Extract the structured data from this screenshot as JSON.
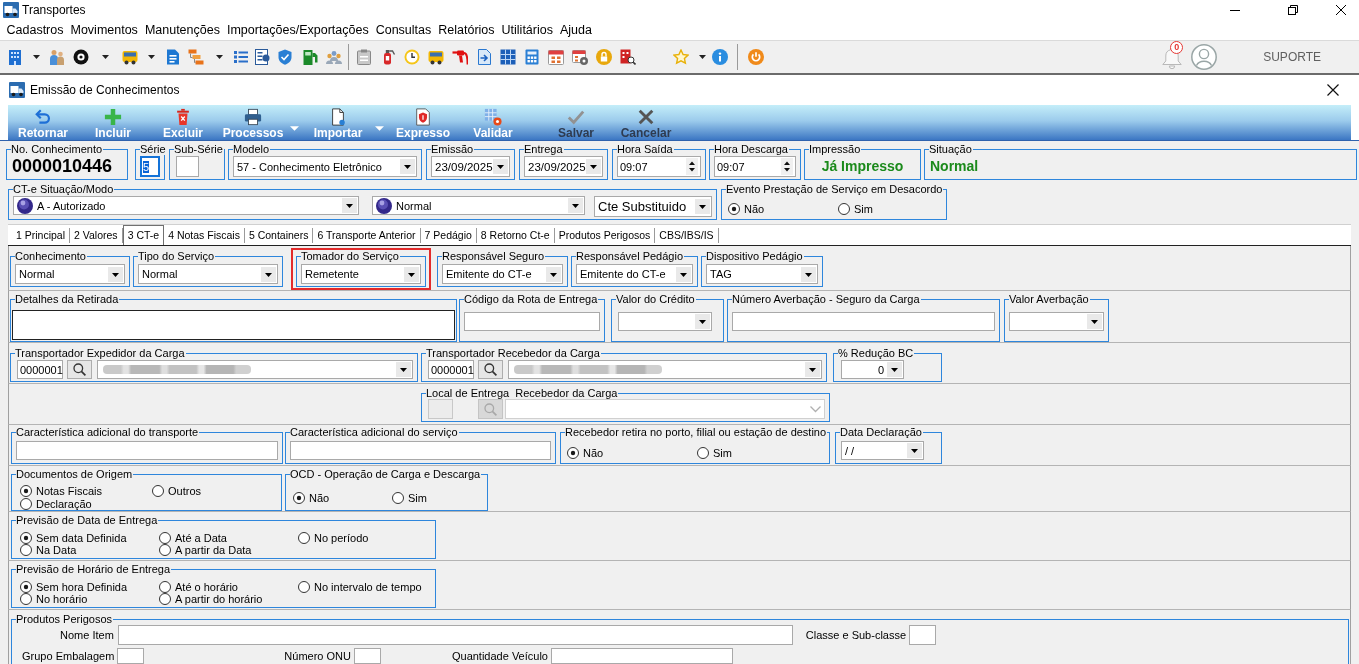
{
  "window": {
    "title": "Transportes"
  },
  "menu": [
    {
      "label": "Cadastros"
    },
    {
      "label": "Movimentos"
    },
    {
      "label": "Manutenções"
    },
    {
      "label": "Importações/Exportações"
    },
    {
      "label": "Consultas"
    },
    {
      "label": "Relatórios"
    },
    {
      "label": "Utilitários"
    },
    {
      "label": "Ajuda"
    }
  ],
  "toolbar": {
    "notification_count": "0",
    "user": "SUPORTE"
  },
  "form_window": {
    "title": "Emissão de Conhecimentos"
  },
  "actions": [
    {
      "label": "Retornar",
      "dropdown": false,
      "disabled": false
    },
    {
      "label": "Incluir",
      "dropdown": false,
      "disabled": false
    },
    {
      "label": "Excluir",
      "dropdown": false,
      "disabled": false
    },
    {
      "label": "Processos",
      "dropdown": true,
      "disabled": false
    },
    {
      "label": "Importar",
      "dropdown": true,
      "disabled": false
    },
    {
      "label": "Expresso",
      "dropdown": false,
      "disabled": false
    },
    {
      "label": "Validar",
      "dropdown": false,
      "disabled": false
    },
    {
      "label": "Salvar",
      "dropdown": false,
      "disabled": true
    },
    {
      "label": "Cancelar",
      "dropdown": false,
      "disabled": true
    }
  ],
  "header": {
    "rows": [
      {
        "groups": [
          {
            "label": "No. Conhecimento",
            "fields": [
              {
                "kind": "number",
                "value": "0000010446"
              }
            ]
          },
          {
            "label": "Série",
            "fields": [
              {
                "kind": "input",
                "value": "5",
                "focused": true
              }
            ]
          },
          {
            "label": "Sub-Série",
            "fields": [
              {
                "kind": "input",
                "focused": false
              }
            ]
          },
          {
            "label": "Modelo",
            "fields": [
              {
                "kind": "select",
                "value": "57 - Conhecimento Eletrônico"
              }
            ]
          },
          {
            "label": "Emissão",
            "fields": [
              {
                "kind": "select",
                "value": "23/09/2025"
              }
            ]
          },
          {
            "label": "Entrega",
            "fields": [
              {
                "kind": "select",
                "value": "23/09/2025"
              }
            ]
          },
          {
            "label": "Hora Saída",
            "fields": [
              {
                "kind": "spin",
                "value": "09:07"
              }
            ]
          },
          {
            "label": "Hora Descarga",
            "fields": [
              {
                "kind": "spin",
                "value": "09:07"
              }
            ]
          },
          {
            "label": "Impressão",
            "fields": [
              {
                "kind": "status",
                "value": "Já Impresso"
              }
            ]
          },
          {
            "label": "Situação",
            "fields": [
              {
                "kind": "status",
                "value": "Normal"
              }
            ]
          }
        ]
      },
      {
        "groups": [
          {
            "label": "CT-e Situação/Modo",
            "fields": [
              {
                "kind": "ballselect",
                "value": "A - Autorizado"
              },
              {
                "kind": "ballselect",
                "value": "Normal"
              },
              {
                "kind": "select",
                "value": "Cte Substituido"
              }
            ]
          },
          {
            "label": "Evento Prestação de Serviço em Desacordo",
            "fields": [
              {
                "kind": "radio",
                "options": [
                  {
                    "label": "Não",
                    "selected": true
                  },
                  {
                    "label": "Sim",
                    "selected": false
                  }
                ]
              }
            ]
          }
        ]
      }
    ]
  },
  "tabs": [
    {
      "label": "1 Principal",
      "selected": false
    },
    {
      "label": "2 Valores",
      "selected": false
    },
    {
      "label": "3 CT-e",
      "selected": true
    },
    {
      "label": "4 Notas Fiscais",
      "selected": false
    },
    {
      "label": "5 Containers",
      "selected": false
    },
    {
      "label": "6 Transporte Anterior",
      "selected": false
    },
    {
      "label": "7 Pedágio",
      "selected": false
    },
    {
      "label": "8 Retorno Ct-e",
      "selected": false
    },
    {
      "label": "Produtos Perigosos",
      "selected": false
    },
    {
      "label": "CBS/IBS/IS",
      "selected": false
    }
  ],
  "tab_body": {
    "rows": [
      {
        "groups": [
          {
            "label": "Conhecimento",
            "highlighted": false,
            "fields": [
              {
                "kind": "select",
                "value": "Normal"
              }
            ]
          },
          {
            "label": "Tipo do Serviço",
            "highlighted": false,
            "fields": [
              {
                "kind": "select",
                "value": "Normal"
              }
            ]
          },
          {
            "label": "Tomador do Serviço",
            "highlighted": true,
            "fields": [
              {
                "kind": "select",
                "value": "Remetente"
              }
            ]
          },
          {
            "label": "Responsável Seguro",
            "highlighted": false,
            "fields": [
              {
                "kind": "select",
                "value": "Emitente do CT-e"
              }
            ]
          },
          {
            "label": "Responsável Pedágio",
            "highlighted": false,
            "fields": [
              {
                "kind": "select",
                "value": "Emitente do CT-e"
              }
            ]
          },
          {
            "label": "Dispositivo Pedágio",
            "highlighted": false,
            "fields": [
              {
                "kind": "select",
                "value": "TAG"
              }
            ]
          }
        ]
      },
      {
        "groups": [
          {
            "label": "Detalhes da Retirada",
            "fields": [
              {
                "kind": "textarea"
              }
            ]
          },
          {
            "label": "Código da Rota de Entrega",
            "fields": [
              {
                "kind": "input"
              }
            ]
          },
          {
            "label": "Valor do Crédito",
            "fields": [
              {
                "kind": "select"
              }
            ]
          },
          {
            "label": "Número Averbação - Seguro da Carga",
            "fields": [
              {
                "kind": "input"
              }
            ]
          },
          {
            "label": "Valor Averbação",
            "fields": [
              {
                "kind": "select"
              }
            ]
          }
        ]
      },
      {
        "groups": [
          {
            "label": "Transportador Expedidor da Carga",
            "fields": [
              {
                "kind": "lookup",
                "code": "0000001",
                "redacted": true,
                "disabled": false
              }
            ]
          },
          {
            "label": "Transportador Recebedor da Carga",
            "fields": [
              {
                "kind": "lookup",
                "code": "0000001",
                "redacted": true,
                "disabled": false
              }
            ]
          },
          {
            "label": "% Redução BC",
            "fields": [
              {
                "kind": "select",
                "value": "0"
              }
            ]
          }
        ]
      },
      {
        "groups": [
          {
            "label": "Local de Entrega  Recebedor da Carga",
            "fields": [
              {
                "kind": "lookup",
                "redacted": false,
                "disabled": true
              }
            ]
          }
        ]
      },
      {
        "groups": [
          {
            "label": "Característica adicional do transporte",
            "fields": [
              {
                "kind": "input"
              }
            ]
          },
          {
            "label": "Característica adicional do serviço",
            "fields": [
              {
                "kind": "input"
              }
            ]
          },
          {
            "label": "Recebedor retira no porto, filial ou estação de destino",
            "fields": [
              {
                "kind": "radio",
                "options": [
                  {
                    "label": "Não",
                    "selected": true
                  },
                  {
                    "label": "Sim",
                    "selected": false
                  }
                ]
              }
            ]
          },
          {
            "label": "Data Declaração",
            "fields": [
              {
                "kind": "select",
                "value": "/ /"
              }
            ]
          }
        ]
      },
      {
        "groups": [
          {
            "label": "Documentos de Origem",
            "fields": [
              {
                "kind": "radio",
                "options": [
                  {
                    "label": "Notas Fiscais",
                    "selected": true
                  },
                  {
                    "label": "Outros",
                    "selected": false
                  },
                  {
                    "label": "Declaração",
                    "selected": false
                  }
                ]
              }
            ]
          },
          {
            "label": "OCD - Operação de Carga e Descarga",
            "fields": [
              {
                "kind": "radio",
                "options": [
                  {
                    "label": "Não",
                    "selected": true
                  },
                  {
                    "label": "Sim",
                    "selected": false
                  }
                ]
              }
            ]
          }
        ]
      },
      {
        "groups": [
          {
            "label": "Previsão de Data de Entrega",
            "fields": [
              {
                "kind": "radio",
                "options": [
                  {
                    "label": "Sem data Definida",
                    "selected": true
                  },
                  {
                    "label": "Até a Data",
                    "selected": false
                  },
                  {
                    "label": "No período",
                    "selected": false
                  },
                  {
                    "label": "Na Data",
                    "selected": false
                  },
                  {
                    "label": "A partir da Data",
                    "selected": false
                  }
                ]
              }
            ]
          }
        ]
      },
      {
        "groups": [
          {
            "label": "Previsão de Horário de Entrega",
            "fields": [
              {
                "kind": "radio",
                "options": [
                  {
                    "label": "Sem hora Definida",
                    "selected": true
                  },
                  {
                    "label": "Até o horário",
                    "selected": false
                  },
                  {
                    "label": "No intervalo de tempo",
                    "selected": false
                  },
                  {
                    "label": "No horário",
                    "selected": false
                  },
                  {
                    "label": "A partir do horário",
                    "selected": false
                  }
                ]
              }
            ]
          }
        ]
      },
      {
        "groups": [
          {
            "label": "Produtos Perigosos",
            "fields": [
              {
                "kind": "labeled_input",
                "label": "Nome Item"
              },
              {
                "kind": "labeled_input",
                "label": "Classe e Sub-classe"
              },
              {
                "kind": "labeled_input",
                "label": "Grupo Embalagem"
              },
              {
                "kind": "labeled_input",
                "label": "Número ONU"
              },
              {
                "kind": "labeled_input",
                "label": "Quantidade Veículo"
              }
            ]
          }
        ]
      }
    ]
  }
}
